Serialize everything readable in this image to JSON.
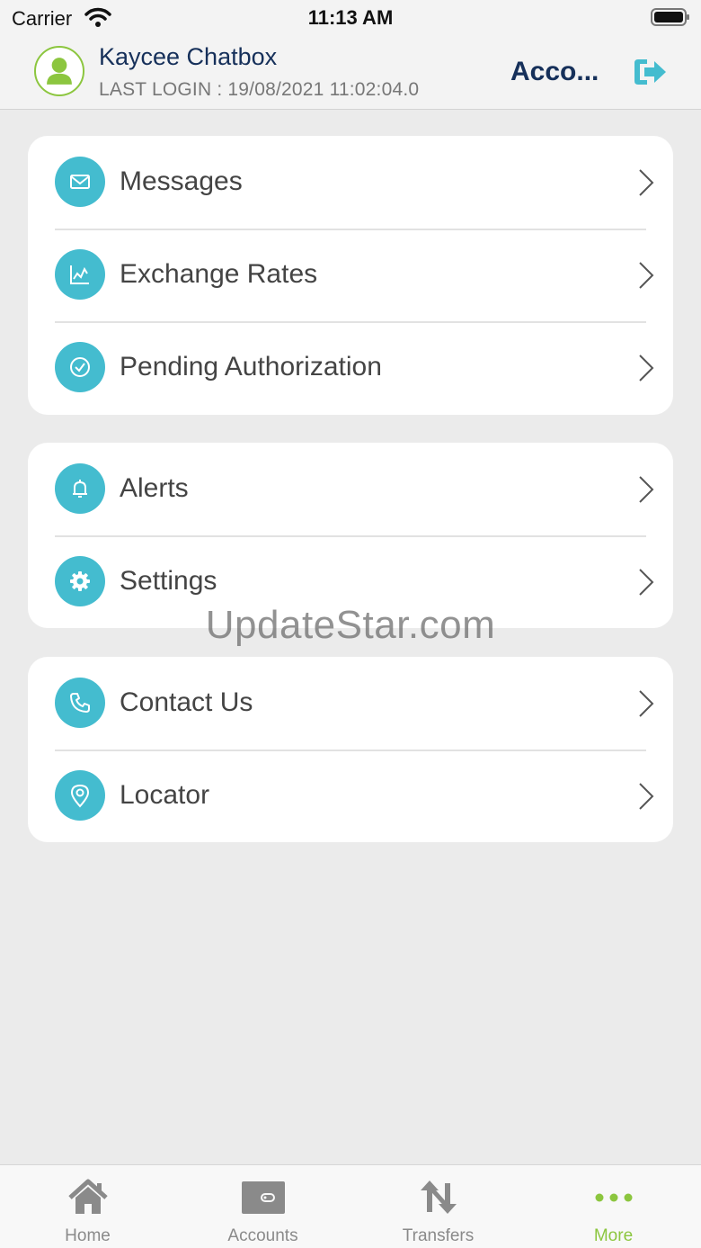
{
  "status_bar": {
    "carrier": "Carrier",
    "time": "11:13 AM"
  },
  "header": {
    "user_name": "Kaycee Chatbox",
    "last_login": "LAST LOGIN : 19/08/2021 11:02:04.0",
    "account_link": "Acco..."
  },
  "menu_groups": [
    {
      "items": [
        {
          "label": "Messages",
          "icon": "envelope-icon"
        },
        {
          "label": "Exchange Rates",
          "icon": "chart-icon"
        },
        {
          "label": "Pending Authorization",
          "icon": "check-circle-icon"
        }
      ]
    },
    {
      "items": [
        {
          "label": "Alerts",
          "icon": "bell-icon"
        },
        {
          "label": "Settings",
          "icon": "gear-icon"
        }
      ]
    },
    {
      "items": [
        {
          "label": "Contact Us",
          "icon": "phone-icon"
        },
        {
          "label": "Locator",
          "icon": "location-pin-icon"
        }
      ]
    }
  ],
  "watermark": "UpdateStar.com",
  "tabs": [
    {
      "label": "Home",
      "icon": "home-icon"
    },
    {
      "label": "Accounts",
      "icon": "wallet-icon"
    },
    {
      "label": "Transfers",
      "icon": "transfer-arrows-icon"
    },
    {
      "label": "More",
      "icon": "more-dots-icon",
      "active": true
    }
  ],
  "colors": {
    "accent_teal": "#44bccf",
    "accent_green": "#8cc63f",
    "navy": "#16305a",
    "background": "#ebebeb"
  }
}
